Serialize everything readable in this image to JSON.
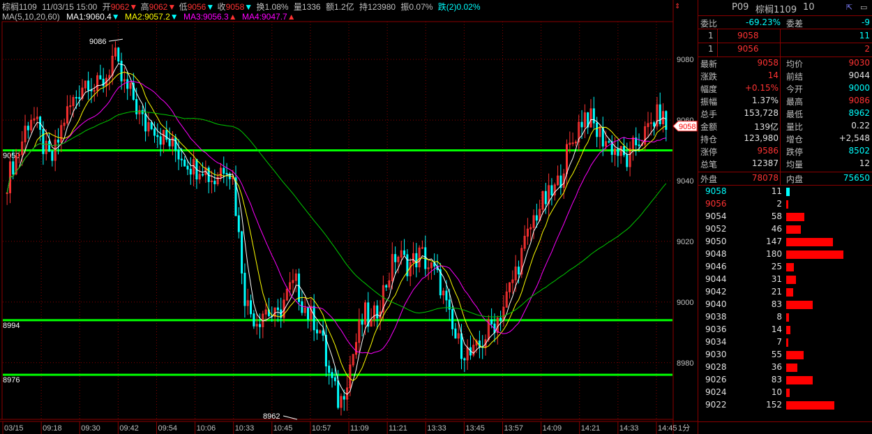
{
  "header": {
    "symbol": "棕榈1109",
    "datetime": "11/03/15 15:00",
    "open_label": "开",
    "open_value": "9062",
    "high_label": "高",
    "high_value": "9062",
    "low_label": "低",
    "low_value": "9056",
    "close_label": "收",
    "close_value": "9058",
    "turnover_label": "换",
    "turnover_value": "1.08%",
    "volume_label": "量",
    "volume_value": "1336",
    "amount_label": "额",
    "amount_value": "1.2亿",
    "oi_label": "持",
    "oi_value": "123980",
    "amplitude_label": "振",
    "amplitude_value": "0.07%",
    "change_label": "跌(2)",
    "change_value": "0.02%"
  },
  "ma_legend": {
    "title": "MA(5,10,20,60)",
    "items": [
      {
        "name": "MA1",
        "value": "9060.4",
        "arrow": "▼",
        "color": "#ffffff"
      },
      {
        "name": "MA2",
        "value": "9057.2",
        "arrow": "▼",
        "color": "#ffff00"
      },
      {
        "name": "MA3",
        "value": "9056.3",
        "arrow": "▲",
        "color": "#ff00ff"
      },
      {
        "name": "MA4",
        "value": "9047.7",
        "arrow": "▲",
        "color": "#00ff00"
      }
    ]
  },
  "chart_data": {
    "type": "candlestick",
    "ylim": [
      8962,
      9092
    ],
    "y_ticks": [
      9080,
      9060,
      9040,
      9020,
      9000,
      8980
    ],
    "x_labels": [
      "03/15",
      "09:18",
      "09:30",
      "09:42",
      "09:54",
      "10:06",
      "10:33",
      "10:45",
      "10:57",
      "11:09",
      "11:21",
      "13:33",
      "13:45",
      "13:57",
      "14:09",
      "14:21",
      "14:33",
      "14:45"
    ],
    "x_unit_label": "1分",
    "last_price_tag": "9058",
    "horizontal_lines": [
      {
        "value": 9050,
        "label": "9050"
      },
      {
        "value": 8994,
        "label": "8994"
      },
      {
        "value": 8976,
        "label": "8976"
      }
    ],
    "annotations": [
      {
        "text": "9086",
        "value": 9086
      },
      {
        "text": "8962",
        "value": 8962
      }
    ],
    "close_path": [
      9040,
      9046,
      9050,
      9058,
      9062,
      9056,
      9050,
      9046,
      9052,
      9060,
      9064,
      9068,
      9072,
      9074,
      9070,
      9072,
      9075,
      9082,
      9074,
      9070,
      9068,
      9062,
      9058,
      9060,
      9056,
      9054,
      9052,
      9050,
      9048,
      9046,
      9044,
      9046,
      9042,
      9040,
      9044,
      9046,
      9040,
      9020,
      9000,
      8996,
      8994,
      8998,
      8996,
      8994,
      9000,
      9004,
      9006,
      9000,
      8996,
      8994,
      8990,
      8978,
      8972,
      8966,
      8974,
      8982,
      8990,
      8996,
      8992,
      8998,
      9004,
      9010,
      9016,
      9014,
      9012,
      9014,
      9016,
      9012,
      9010,
      9006,
      8998,
      8990,
      8986,
      8984,
      8982,
      8984,
      8988,
      8992,
      8994,
      8998,
      9004,
      9010,
      9016,
      9022,
      9028,
      9032,
      9034,
      9036,
      9040,
      9048,
      9052,
      9058,
      9062,
      9060,
      9056,
      9054,
      9052,
      9050,
      9048,
      9046,
      9052,
      9054,
      9056,
      9060,
      9062,
      9058
    ]
  },
  "panel": {
    "code": "P09",
    "name": "棕榈1109",
    "num": "10",
    "weibi_label": "委比",
    "weibi_value": "-69.23%",
    "weicha_label": "委差",
    "weicha_value": "-9",
    "ask": {
      "idx": "1",
      "price": "9058",
      "qty": "11"
    },
    "bid": {
      "idx": "1",
      "price": "9056",
      "qty": "2"
    },
    "stats": [
      {
        "l1": "最新",
        "v1": "9058",
        "c1": "red",
        "l2": "均价",
        "v2": "9030",
        "c2": "red"
      },
      {
        "l1": "涨跌",
        "v1": "14",
        "c1": "red",
        "l2": "前结",
        "v2": "9044",
        "c2": "white"
      },
      {
        "l1": "幅度",
        "v1": "+0.15%",
        "c1": "red",
        "l2": "今开",
        "v2": "9000",
        "c2": "cyan"
      },
      {
        "l1": "振幅",
        "v1": "1.37%",
        "c1": "white",
        "l2": "最高",
        "v2": "9086",
        "c2": "red"
      },
      {
        "l1": "总手",
        "v1": "153,728",
        "c1": "white",
        "l2": "最低",
        "v2": "8962",
        "c2": "cyan"
      },
      {
        "l1": "金额",
        "v1": "139亿",
        "c1": "white",
        "l2": "量比",
        "v2": "0.22",
        "c2": "white"
      },
      {
        "l1": "持仓",
        "v1": "123,980",
        "c1": "white",
        "l2": "增仓",
        "v2": "+2,548",
        "c2": "white"
      },
      {
        "l1": "涨停",
        "v1": "9586",
        "c1": "red",
        "l2": "跌停",
        "v2": "8502",
        "c2": "cyan"
      },
      {
        "l1": "总笔",
        "v1": "12387",
        "c1": "white",
        "l2": "均量",
        "v2": "12",
        "c2": "white"
      }
    ],
    "outer_label": "外盘",
    "outer_value": "78078",
    "inner_label": "内盘",
    "inner_value": "75650",
    "depth": [
      {
        "price": "9058",
        "qty": "11",
        "qty_num": 11,
        "pcolor": "cyan",
        "bcolor": "#00ffff"
      },
      {
        "price": "9056",
        "qty": "2",
        "qty_num": 2,
        "pcolor": "red",
        "bcolor": "#ff0000"
      },
      {
        "price": "9054",
        "qty": "58",
        "qty_num": 58,
        "pcolor": "white",
        "bcolor": "#ff0000"
      },
      {
        "price": "9052",
        "qty": "46",
        "qty_num": 46,
        "pcolor": "white",
        "bcolor": "#ff0000"
      },
      {
        "price": "9050",
        "qty": "147",
        "qty_num": 147,
        "pcolor": "white",
        "bcolor": "#ff0000"
      },
      {
        "price": "9048",
        "qty": "180",
        "qty_num": 180,
        "pcolor": "white",
        "bcolor": "#ff0000"
      },
      {
        "price": "9046",
        "qty": "25",
        "qty_num": 25,
        "pcolor": "white",
        "bcolor": "#ff0000"
      },
      {
        "price": "9044",
        "qty": "31",
        "qty_num": 31,
        "pcolor": "white",
        "bcolor": "#ff0000"
      },
      {
        "price": "9042",
        "qty": "21",
        "qty_num": 21,
        "pcolor": "white",
        "bcolor": "#ff0000"
      },
      {
        "price": "9040",
        "qty": "83",
        "qty_num": 83,
        "pcolor": "white",
        "bcolor": "#ff0000"
      },
      {
        "price": "9038",
        "qty": "8",
        "qty_num": 8,
        "pcolor": "white",
        "bcolor": "#ff0000"
      },
      {
        "price": "9036",
        "qty": "14",
        "qty_num": 14,
        "pcolor": "white",
        "bcolor": "#ff0000"
      },
      {
        "price": "9034",
        "qty": "7",
        "qty_num": 7,
        "pcolor": "white",
        "bcolor": "#ff0000"
      },
      {
        "price": "9030",
        "qty": "55",
        "qty_num": 55,
        "pcolor": "white",
        "bcolor": "#ff0000"
      },
      {
        "price": "9028",
        "qty": "36",
        "qty_num": 36,
        "pcolor": "white",
        "bcolor": "#ff0000"
      },
      {
        "price": "9026",
        "qty": "83",
        "qty_num": 83,
        "pcolor": "white",
        "bcolor": "#ff0000"
      },
      {
        "price": "9024",
        "qty": "10",
        "qty_num": 10,
        "pcolor": "white",
        "bcolor": "#ff0000"
      },
      {
        "price": "9022",
        "qty": "152",
        "qty_num": 152,
        "pcolor": "white",
        "bcolor": "#ff0000"
      }
    ]
  },
  "colors": {
    "up": "#ff3232",
    "down": "#00ffff",
    "grid": "#8b0000",
    "hline": "#00ff00",
    "ma1": "#ffffff",
    "ma2": "#ffff00",
    "ma3": "#ff00ff",
    "ma4": "#00cc00"
  }
}
